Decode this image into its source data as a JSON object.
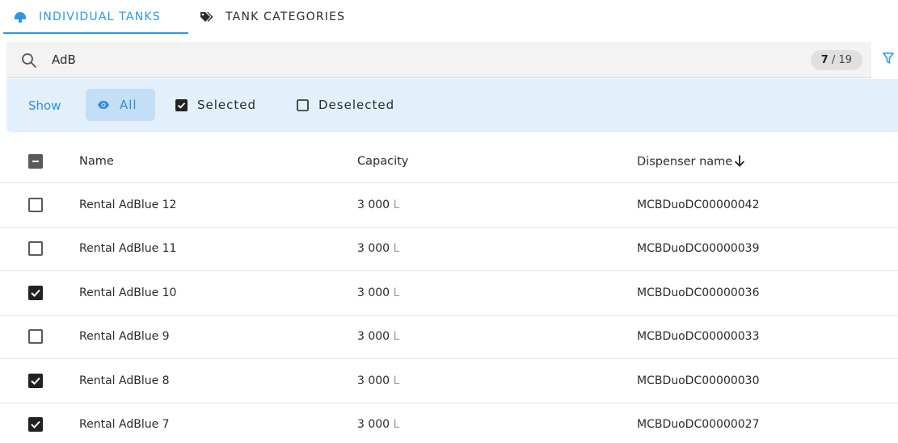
{
  "tabs": {
    "individual_tanks": "INDIVIDUAL TANKS",
    "tank_categories": "TANK CATEGORIES",
    "active": "individual_tanks"
  },
  "search": {
    "value": "AdB",
    "placeholder": "",
    "count_current": "7",
    "count_total": " / 19"
  },
  "show_filter": {
    "label": "Show",
    "all": "All",
    "selected": "Selected",
    "deselected": "Deselected",
    "active": "all"
  },
  "table": {
    "headers": {
      "name": "Name",
      "capacity": "Capacity",
      "dispenser": "Dispenser name"
    },
    "sort_column": "dispenser",
    "sort_direction": "descending",
    "select_all_state": "indeterminate",
    "rows": [
      {
        "checked": false,
        "name": "Rental AdBlue 12",
        "capacity": "3 000",
        "unit": "L",
        "dispenser": "MCBDuoDC00000042"
      },
      {
        "checked": false,
        "name": "Rental AdBlue 11",
        "capacity": "3 000",
        "unit": "L",
        "dispenser": "MCBDuoDC00000039"
      },
      {
        "checked": true,
        "name": "Rental AdBlue 10",
        "capacity": "3 000",
        "unit": "L",
        "dispenser": "MCBDuoDC00000036"
      },
      {
        "checked": false,
        "name": "Rental AdBlue 9",
        "capacity": "3 000",
        "unit": "L",
        "dispenser": "MCBDuoDC00000033"
      },
      {
        "checked": true,
        "name": "Rental AdBlue 8",
        "capacity": "3 000",
        "unit": "L",
        "dispenser": "MCBDuoDC00000030"
      },
      {
        "checked": true,
        "name": "Rental AdBlue 7",
        "capacity": "3 000",
        "unit": "L",
        "dispenser": "MCBDuoDC00000027"
      }
    ]
  },
  "colors": {
    "accent": "#2f96e6",
    "show_bar_bg": "#e2f0fc",
    "active_chip_bg": "#c4def6",
    "search_bg": "#f3f3f3"
  },
  "icons": {
    "tanks_tab": "tank-cloud-icon",
    "categories_tab": "tags-icon",
    "search": "search-icon",
    "filter": "filter-icon",
    "all": "eye-icon",
    "sort": "arrow-down-icon"
  }
}
